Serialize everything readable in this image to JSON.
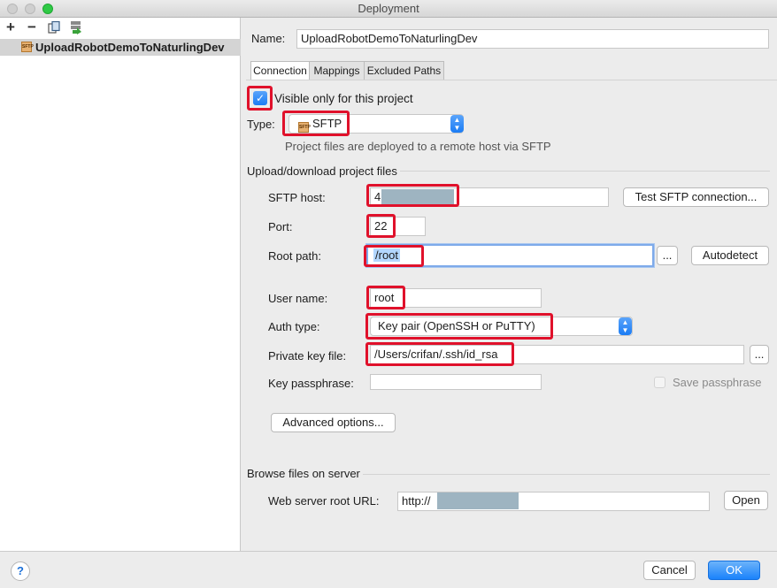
{
  "window": {
    "title": "Deployment"
  },
  "left_panel": {
    "toolbar": {
      "add": "+",
      "remove": "−"
    },
    "server_name": "UploadRobotDemoToNaturlingDev"
  },
  "name": {
    "label": "Name:",
    "value": "UploadRobotDemoToNaturlingDev"
  },
  "tabs": [
    {
      "label": "Connection",
      "active": true
    },
    {
      "label": "Mappings",
      "active": false
    },
    {
      "label": "Excluded Paths",
      "active": false
    }
  ],
  "visible_only": {
    "label": "Visible only for this project",
    "checked": true
  },
  "type": {
    "label": "Type:",
    "value": "SFTP",
    "icon_text": "SFTP",
    "description": "Project files are deployed to a remote host via SFTP"
  },
  "upload_section": {
    "title": "Upload/download project files"
  },
  "sftp_host": {
    "label": "SFTP host:",
    "value": "4",
    "test_button": "Test SFTP connection..."
  },
  "port": {
    "label": "Port:",
    "value": "22"
  },
  "root_path": {
    "label": "Root path:",
    "value": "/root",
    "browse_button": "...",
    "autodetect_button": "Autodetect"
  },
  "user_name": {
    "label": "User name:",
    "value": "root"
  },
  "auth_type": {
    "label": "Auth type:",
    "value": "Key pair (OpenSSH or PuTTY)"
  },
  "private_key": {
    "label": "Private key file:",
    "value": "/Users/crifan/.ssh/id_rsa",
    "browse_button": "..."
  },
  "key_passphrase": {
    "label": "Key passphrase:",
    "value": "",
    "save_label": "Save passphrase",
    "save_checked": false
  },
  "advanced_button": "Advanced options...",
  "browse_section": {
    "title": "Browse files on server"
  },
  "web_root": {
    "label": "Web server root URL:",
    "value": "http://",
    "open_button": "Open"
  },
  "footer": {
    "help": "?",
    "cancel": "Cancel",
    "ok": "OK"
  },
  "colors": {
    "highlight_red": "#e0112b",
    "accent_blue": "#1a82fb",
    "selection": "#b3d7ff"
  }
}
